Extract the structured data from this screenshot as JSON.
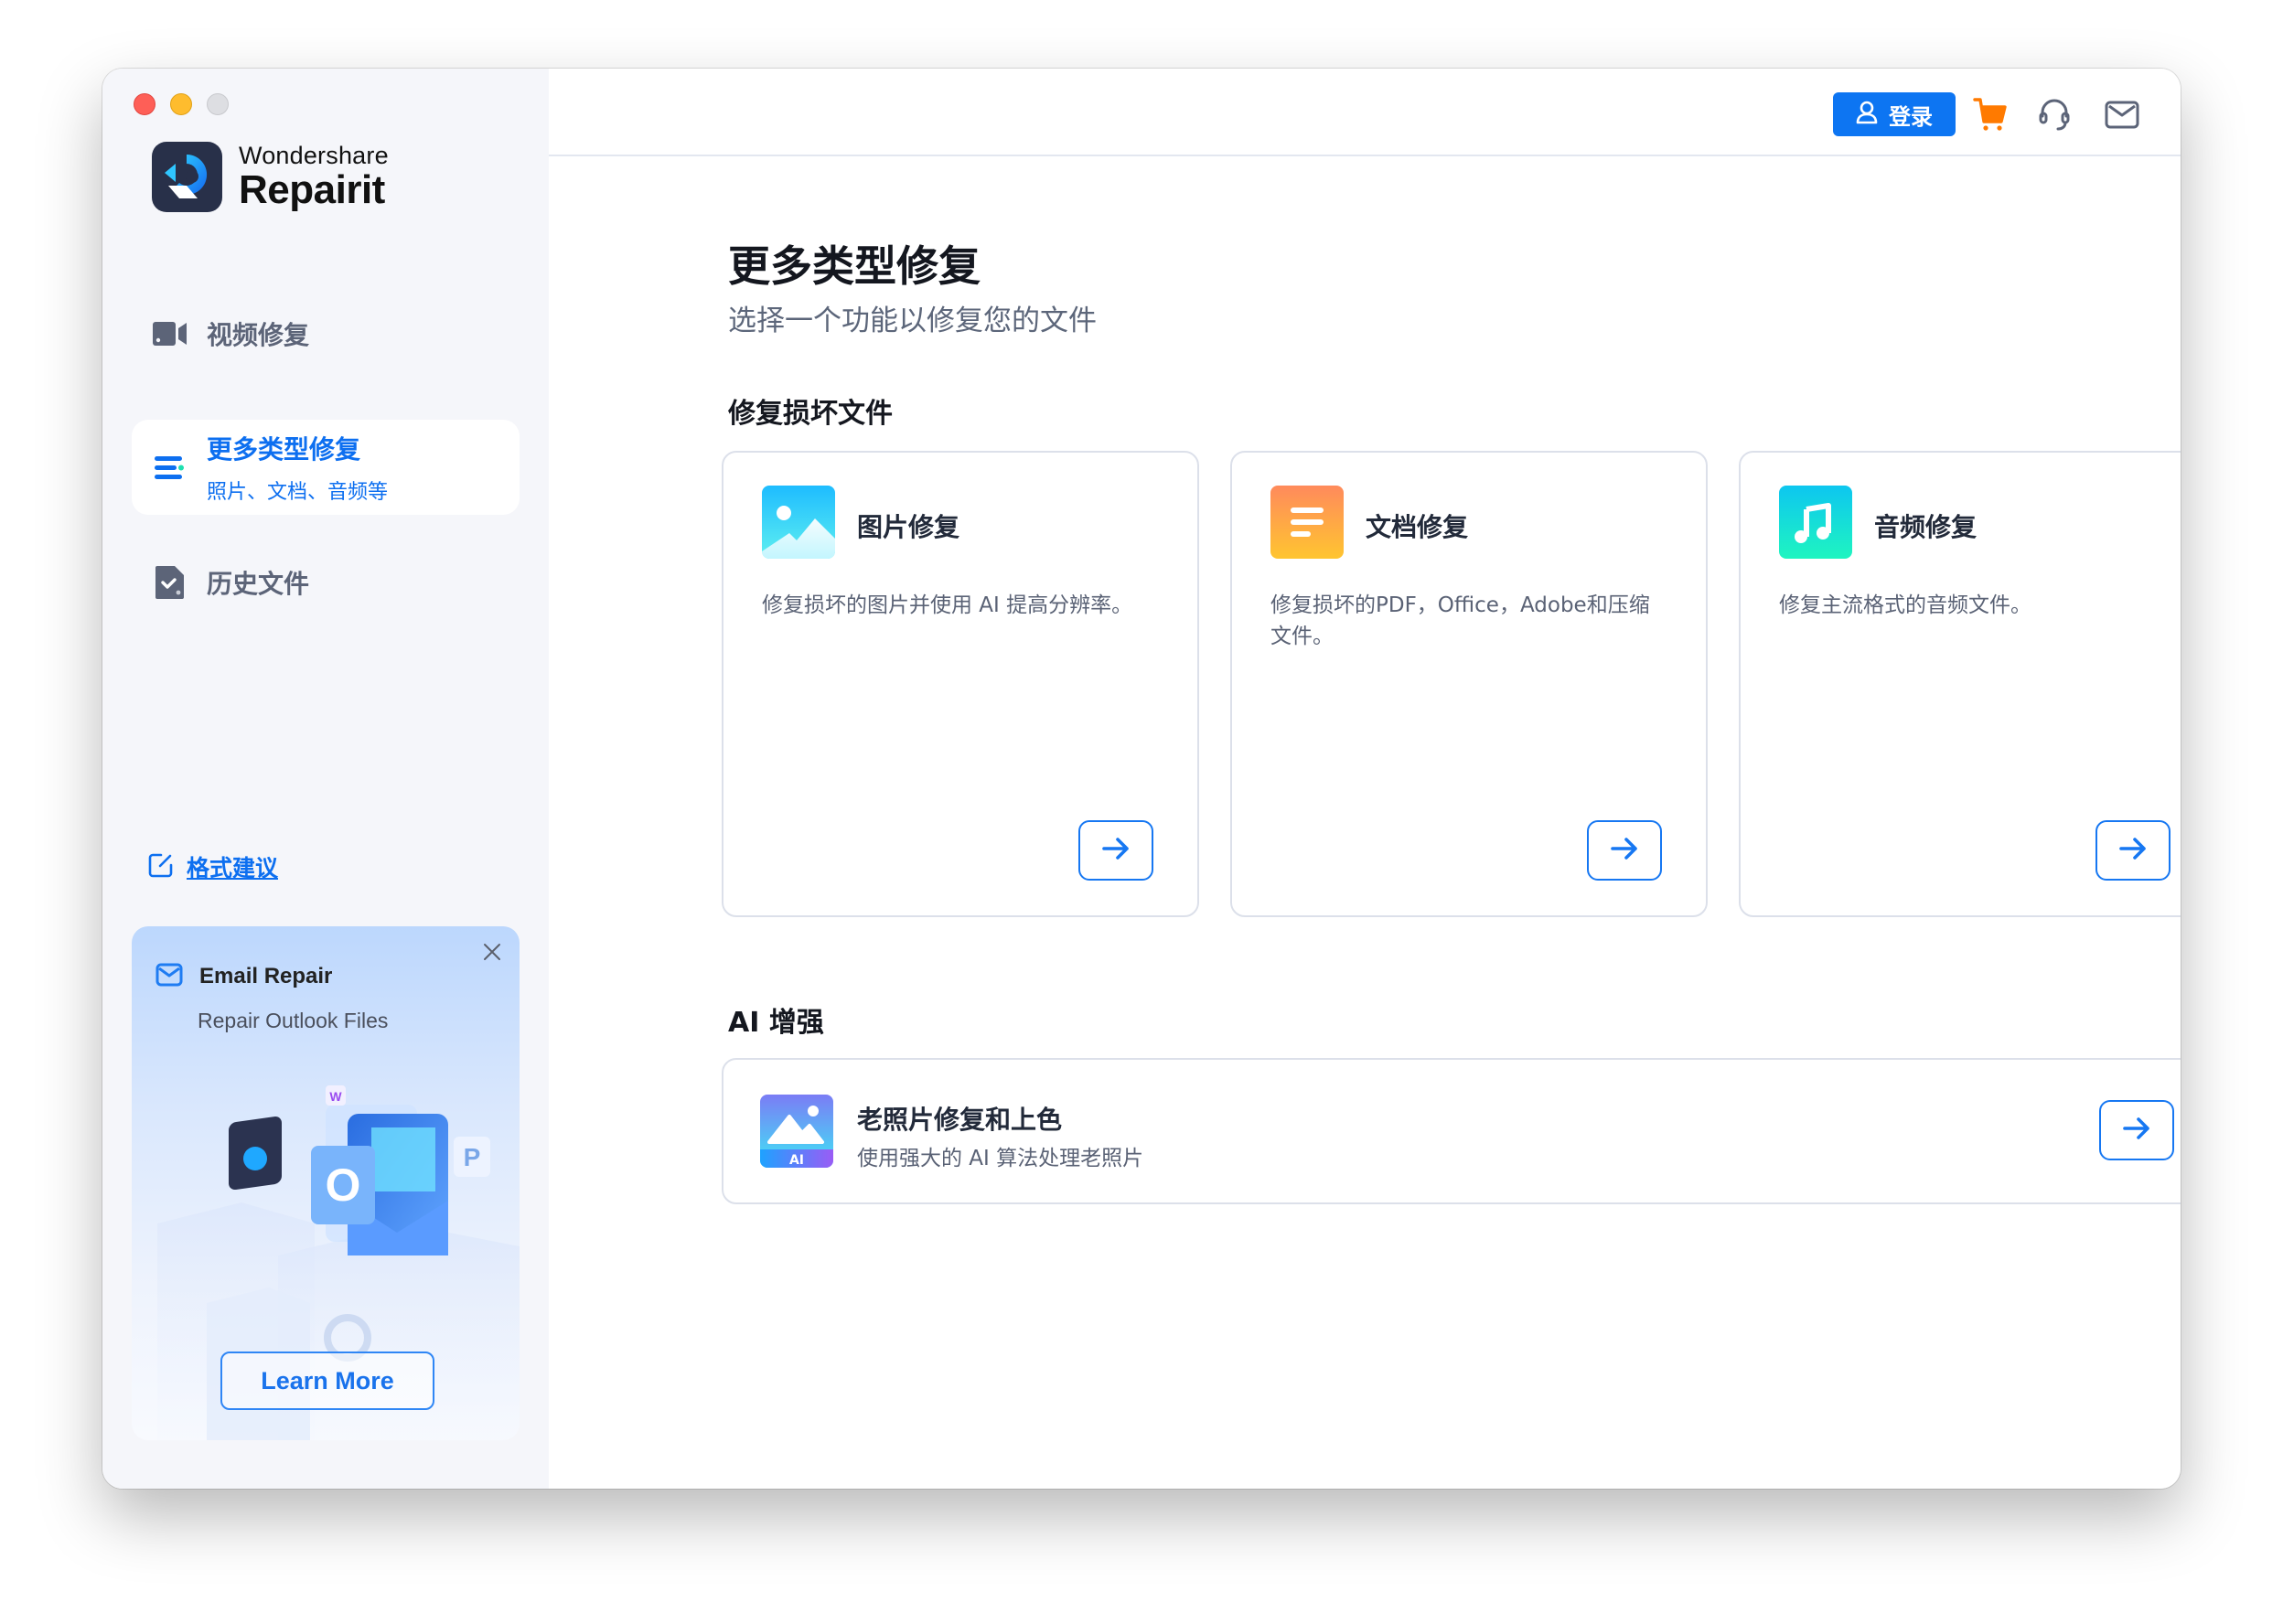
{
  "app": {
    "brand": "Wondershare",
    "product": "Repairit"
  },
  "sidebar": {
    "items": [
      {
        "label": "视频修复",
        "icon": "video-camera-icon",
        "active": false
      },
      {
        "label": "更多类型修复",
        "sublabel": "照片、文档、音频等",
        "icon": "list-icon",
        "active": true
      },
      {
        "label": "历史文件",
        "icon": "history-file-icon",
        "active": false
      }
    ],
    "format_link": "格式建议",
    "promo": {
      "title": "Email Repair",
      "subtitle": "Repair Outlook Files",
      "button": "Learn More",
      "art_letters": {
        "outlook": "O",
        "powerpoint": "P",
        "word": "W"
      }
    }
  },
  "topbar": {
    "login_label": "登录",
    "icons": [
      "cart-icon",
      "headset-icon",
      "mail-icon"
    ]
  },
  "main": {
    "title": "更多类型修复",
    "subtitle": "选择一个功能以修复您的文件",
    "section_repair": "修复损坏文件",
    "cards": [
      {
        "title": "图片修复",
        "desc": "修复损坏的图片并使用 AI 提高分辨率。",
        "icon": "image-icon"
      },
      {
        "title": "文档修复",
        "desc": "修复损坏的PDF，Office，Adobe和压缩文件。",
        "icon": "document-icon"
      },
      {
        "title": "音频修复",
        "desc": "修复主流格式的音频文件。",
        "icon": "music-note-icon"
      }
    ],
    "section_ai": "AI 增强",
    "ai_card": {
      "title": "老照片修复和上色",
      "desc": "使用强大的 AI 算法处理老照片",
      "badge": "AI",
      "icon": "ai-photo-icon"
    }
  },
  "colors": {
    "accent": "#0d75f2",
    "cart": "#ff7a00",
    "sidebar_bg": "#f5f6fa",
    "text_primary": "#14171f",
    "text_secondary": "#5c667a"
  }
}
